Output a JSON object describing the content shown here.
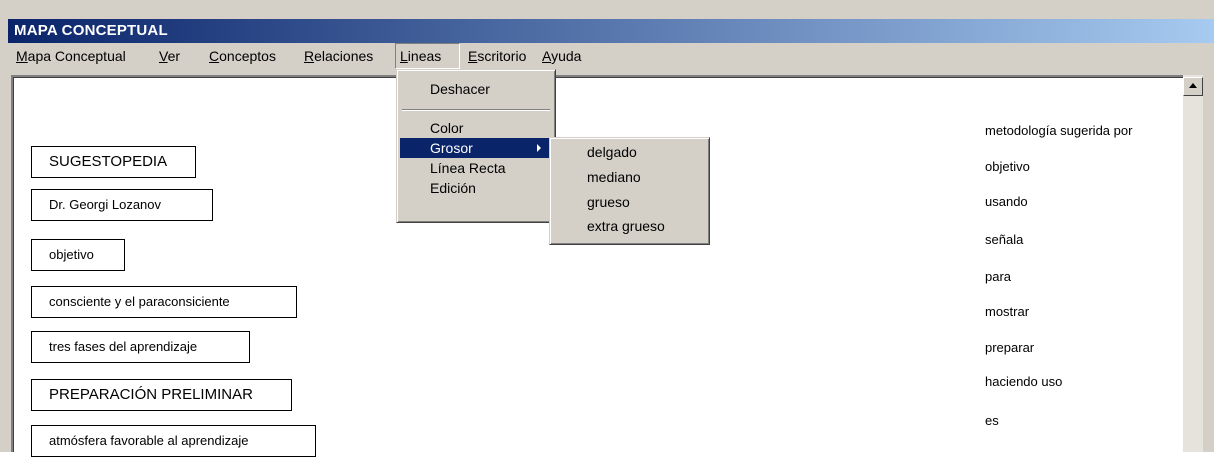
{
  "window": {
    "title": "MAPA CONCEPTUAL"
  },
  "menubar": {
    "items": [
      {
        "label": "Mapa Conceptual",
        "mnemonic": "M"
      },
      {
        "label": "Ver",
        "mnemonic": "V"
      },
      {
        "label": "Conceptos",
        "mnemonic": "C"
      },
      {
        "label": "Relaciones",
        "mnemonic": "R"
      },
      {
        "label": "Lineas",
        "mnemonic": "L"
      },
      {
        "label": "Escritorio",
        "mnemonic": "E"
      },
      {
        "label": "Ayuda",
        "mnemonic": "A"
      }
    ],
    "open_menu": "Lineas"
  },
  "lineas_menu": {
    "items": [
      "Deshacer",
      "Color",
      "Grosor",
      "Línea Recta",
      "Edición"
    ],
    "highlighted": "Grosor"
  },
  "grosor_submenu": {
    "items": [
      "delgado",
      "mediano",
      "grueso",
      "extra grueso"
    ]
  },
  "concepts": [
    "SUGESTOPEDIA",
    "Dr. Georgi Lozanov",
    "objetivo",
    "consciente y el paraconsiciente",
    "tres fases del aprendizaje",
    "PREPARACIÓN PRELIMINAR",
    "atmósfera favorable al aprendizaje"
  ],
  "relations": [
    "metodología sugerida por",
    "objetivo",
    "usando",
    "señala",
    "para",
    "mostrar",
    "preparar",
    "haciendo uso",
    "es"
  ],
  "colors": {
    "title_bar": "#0a246a",
    "menu_highlight": "#0a246a",
    "chrome": "#d4d0c8"
  },
  "icons": {
    "scroll_up": "triangle-up-icon",
    "submenu_arrow": "triangle-right-icon"
  }
}
